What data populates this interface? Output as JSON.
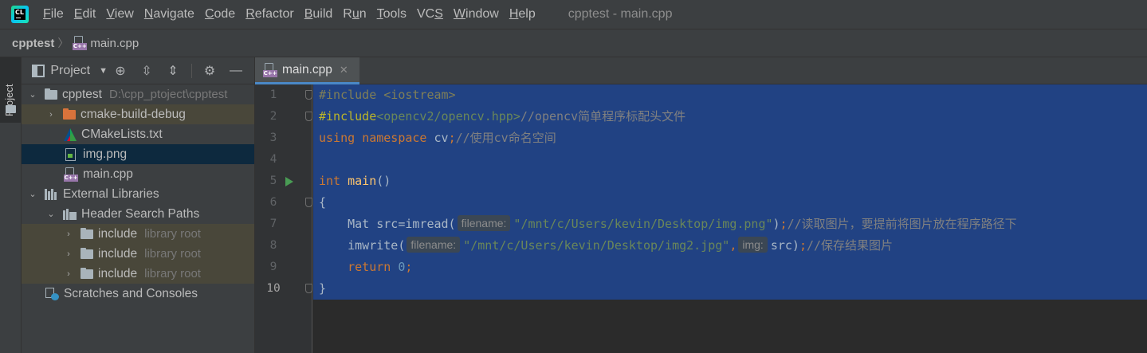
{
  "menubar": {
    "items": [
      "File",
      "Edit",
      "View",
      "Navigate",
      "Code",
      "Refactor",
      "Build",
      "Run",
      "Tools",
      "VCS",
      "Window",
      "Help"
    ],
    "mnemonics": [
      "F",
      "E",
      "V",
      "N",
      "C",
      "R",
      "B",
      "u",
      "T",
      "S",
      "W",
      "H"
    ],
    "window_title": "cpptest - main.cpp"
  },
  "breadcrumb": {
    "project": "cpptest",
    "file": "main.cpp"
  },
  "toolstrip": {
    "project_tab": "Project"
  },
  "project_panel": {
    "title": "Project",
    "tree": [
      {
        "label": "cpptest",
        "hint": "D:\\cpp_ptoject\\cpptest"
      },
      {
        "label": "cmake-build-debug"
      },
      {
        "label": "CMakeLists.txt"
      },
      {
        "label": "img.png"
      },
      {
        "label": "main.cpp"
      },
      {
        "label": "External Libraries"
      },
      {
        "label": "Header Search Paths"
      },
      {
        "label": "include",
        "hint": "library root"
      },
      {
        "label": "include",
        "hint": "library root"
      },
      {
        "label": "include",
        "hint": "library root"
      },
      {
        "label": "Scratches and Consoles"
      }
    ]
  },
  "editor": {
    "tab_label": "main.cpp",
    "line_numbers": [
      "1",
      "2",
      "3",
      "4",
      "5",
      "6",
      "7",
      "8",
      "9",
      "10"
    ],
    "code": {
      "l1": "#include <iostream>",
      "l2_dir": "#include",
      "l2_file": "<opencv2/opencv.hpp>",
      "l2_comment": "//opencv简单程序标配头文件",
      "l3_using": "using",
      "l3_namespace": "namespace",
      "l3_name": " cv",
      "l3_semi": ";",
      "l3_comment": "//使用cv命名空间",
      "l5_type": "int",
      "l5_fn": "main",
      "l5_rest": "()",
      "l6": "{",
      "l7_pre": "    Mat src=imread(",
      "l7_hint": "filename:",
      "l7_str": "\"/mnt/c/Users/kevin/Desktop/img.png\"",
      "l7_post": ")",
      "l7_semi": ";",
      "l7_comment": "//读取图片，要提前将图片放在程序路径下",
      "l8_pre": "    imwrite(",
      "l8_hint1": "filename:",
      "l8_str": "\"/mnt/c/Users/kevin/Desktop/img2.jpg\"",
      "l8_comma": ",",
      "l8_hint2": "img:",
      "l8_post": "src)",
      "l8_semi": ";",
      "l8_comment": "//保存结果图片",
      "l9_ret": "    return",
      "l9_num": " 0",
      "l9_semi": ";",
      "l10": "}"
    }
  },
  "colors": {
    "selection": "#214283",
    "keyword": "#cc7832",
    "string": "#6a8759",
    "comment": "#808080",
    "function": "#ffc66d",
    "number": "#6897bb"
  }
}
